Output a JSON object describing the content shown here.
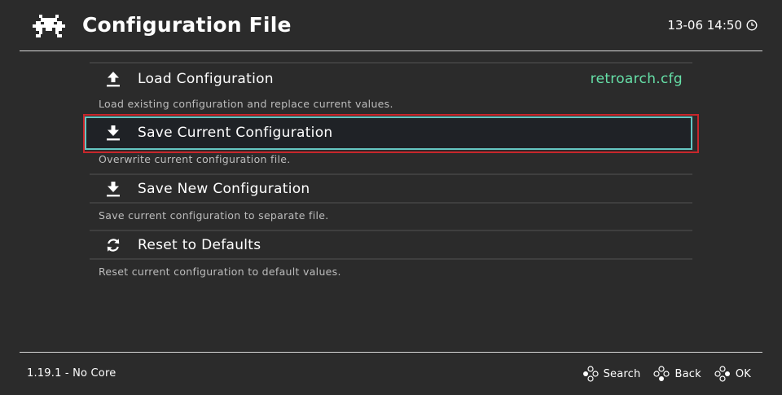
{
  "header": {
    "logo_icon": "retroarch-invader-logo",
    "title": "Configuration File",
    "clock": "13-06 14:50",
    "clock_icon": "clock-icon"
  },
  "menu": {
    "items": [
      {
        "label": "Load Configuration",
        "value": "retroarch.cfg",
        "sublabel": "Load existing configuration and replace current values.",
        "icon": "upload-icon",
        "selected": false
      },
      {
        "label": "Save Current Configuration",
        "value": "",
        "sublabel": "Overwrite current configuration file.",
        "icon": "download-icon",
        "selected": true
      },
      {
        "label": "Save New Configuration",
        "value": "",
        "sublabel": "Save current configuration to separate file.",
        "icon": "download-icon",
        "selected": false
      },
      {
        "label": "Reset to Defaults",
        "value": "",
        "sublabel": "Reset current configuration to default values.",
        "icon": "reset-icon",
        "selected": false
      }
    ]
  },
  "footer": {
    "status": "1.19.1 - No Core",
    "hints": [
      {
        "label": "Search",
        "icon": "gamepad-buttons-icon"
      },
      {
        "label": "Back",
        "icon": "gamepad-buttons-icon"
      },
      {
        "label": "OK",
        "icon": "gamepad-buttons-icon"
      }
    ]
  },
  "colors": {
    "background": "#2b2b2b",
    "value_text": "#66e0a8",
    "selection_border": "#65c7c3",
    "selection_fill": "#1f2226",
    "sublabel_text": "#bdbdbd"
  }
}
